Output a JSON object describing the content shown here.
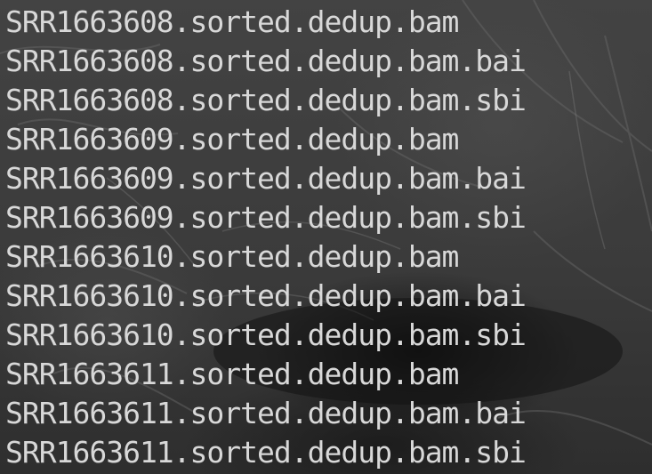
{
  "terminal": {
    "files": [
      "SRR1663608.sorted.dedup.bam",
      "SRR1663608.sorted.dedup.bam.bai",
      "SRR1663608.sorted.dedup.bam.sbi",
      "SRR1663609.sorted.dedup.bam",
      "SRR1663609.sorted.dedup.bam.bai",
      "SRR1663609.sorted.dedup.bam.sbi",
      "SRR1663610.sorted.dedup.bam",
      "SRR1663610.sorted.dedup.bam.bai",
      "SRR1663610.sorted.dedup.bam.sbi",
      "SRR1663611.sorted.dedup.bam",
      "SRR1663611.sorted.dedup.bam.bai",
      "SRR1663611.sorted.dedup.bam.sbi"
    ],
    "colors": {
      "text": "#d8d8d8",
      "background": "#3d3d3d"
    }
  }
}
